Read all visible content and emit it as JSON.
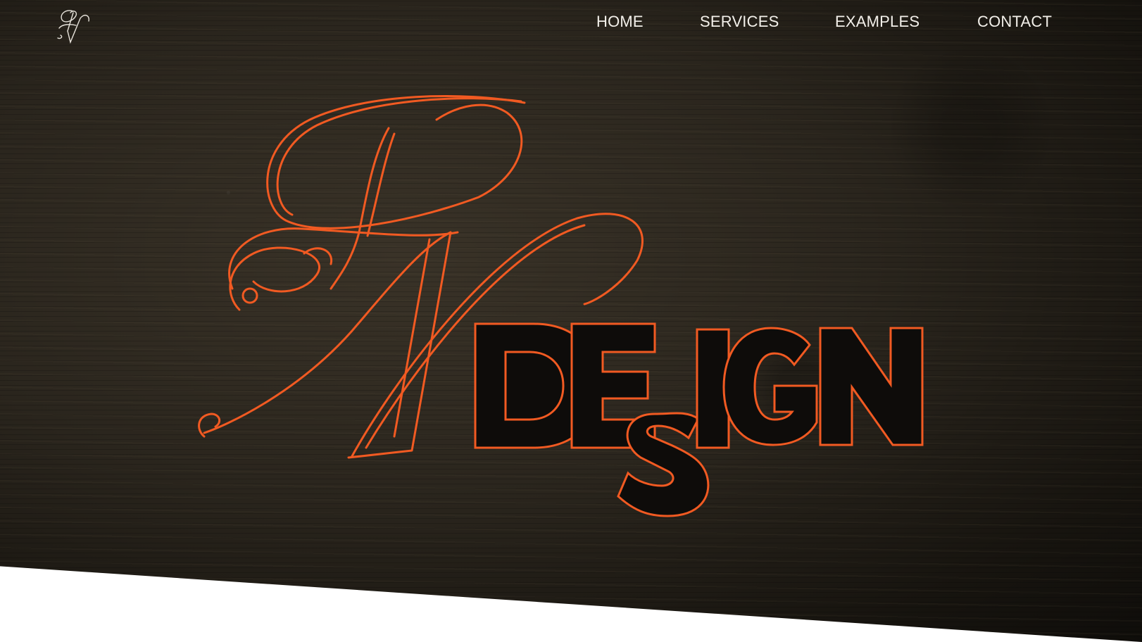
{
  "nav": {
    "items": [
      {
        "label": "HOME"
      },
      {
        "label": "SERVICES"
      },
      {
        "label": "EXAMPLES"
      },
      {
        "label": "CONTACT"
      }
    ]
  },
  "brand": {
    "monogram": "RN",
    "wordmark": "DESIGN",
    "accent_color": "#f15a22",
    "nav_text_color": "#f3f0ea",
    "background_color": "#231e17"
  }
}
